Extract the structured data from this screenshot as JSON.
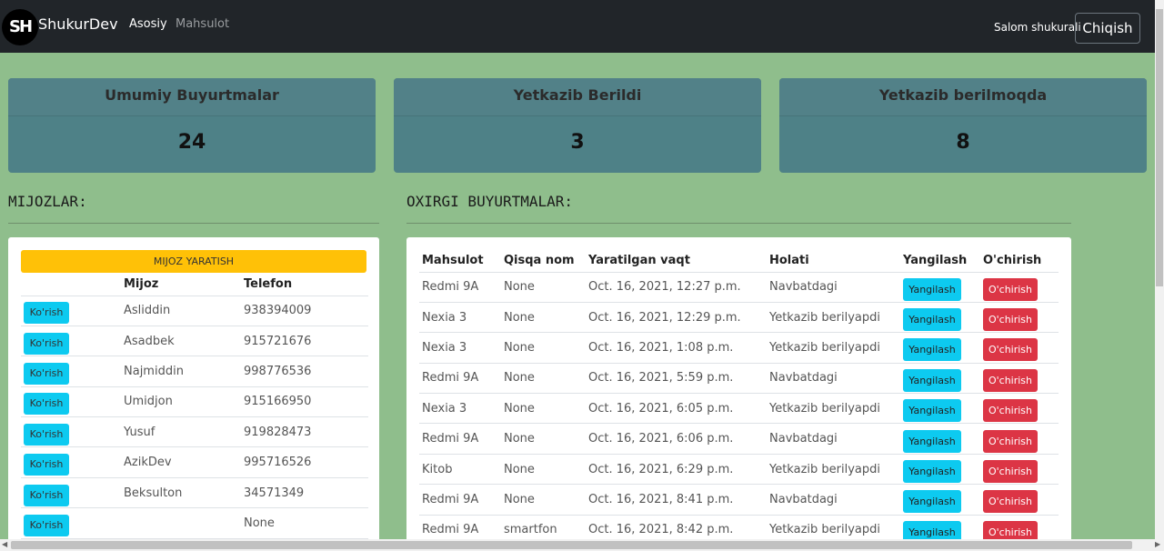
{
  "navbar": {
    "logo_text": "SH",
    "brand": "ShukurDev",
    "links": [
      "Asosiy",
      "Mahsulot"
    ],
    "greeting": "Salom shukurali",
    "logout_label": "Chiqish"
  },
  "stats": [
    {
      "title": "Umumiy Buyurtmalar",
      "value": "24"
    },
    {
      "title": "Yetkazib Berildi",
      "value": "3"
    },
    {
      "title": "Yetkazib berilmoqda",
      "value": "8"
    }
  ],
  "clients": {
    "title": "MIJOZLAR:",
    "create_label": "MIJOZ YARATISH",
    "headers": [
      "",
      "Mijoz",
      "Telefon"
    ],
    "view_label": "Ko'rish",
    "rows": [
      {
        "name": "Asliddin",
        "phone": "938394009"
      },
      {
        "name": "Asadbek",
        "phone": "915721676"
      },
      {
        "name": "Najmiddin",
        "phone": "998776536"
      },
      {
        "name": "Umidjon",
        "phone": "915166950"
      },
      {
        "name": "Yusuf",
        "phone": "919828473"
      },
      {
        "name": "AzikDev",
        "phone": "995716526"
      },
      {
        "name": "Beksulton",
        "phone": "34571349"
      },
      {
        "name": "",
        "phone": "None"
      }
    ]
  },
  "orders": {
    "title": "OXIRGI BUYURTMALAR:",
    "headers": [
      "Mahsulot",
      "Qisqa nom",
      "Yaratilgan vaqt",
      "Holati",
      "Yangilash",
      "O'chirish"
    ],
    "update_label": "Yangilash",
    "delete_label": "O'chirish",
    "rows": [
      {
        "product": "Redmi 9A",
        "short": "None",
        "created": "Oct. 16, 2021, 12:27 p.m.",
        "status": "Navbatdagi"
      },
      {
        "product": "Nexia 3",
        "short": "None",
        "created": "Oct. 16, 2021, 12:29 p.m.",
        "status": "Yetkazib berilyapdi"
      },
      {
        "product": "Nexia 3",
        "short": "None",
        "created": "Oct. 16, 2021, 1:08 p.m.",
        "status": "Yetkazib berilyapdi"
      },
      {
        "product": "Redmi 9A",
        "short": "None",
        "created": "Oct. 16, 2021, 5:59 p.m.",
        "status": "Navbatdagi"
      },
      {
        "product": "Nexia 3",
        "short": "None",
        "created": "Oct. 16, 2021, 6:05 p.m.",
        "status": "Yetkazib berilyapdi"
      },
      {
        "product": "Redmi 9A",
        "short": "None",
        "created": "Oct. 16, 2021, 6:06 p.m.",
        "status": "Navbatdagi"
      },
      {
        "product": "Kitob",
        "short": "None",
        "created": "Oct. 16, 2021, 6:29 p.m.",
        "status": "Yetkazib berilyapdi"
      },
      {
        "product": "Redmi 9A",
        "short": "None",
        "created": "Oct. 16, 2021, 8:41 p.m.",
        "status": "Navbatdagi"
      },
      {
        "product": "Redmi 9A",
        "short": "smartfon",
        "created": "Oct. 16, 2021, 8:42 p.m.",
        "status": "Yetkazib berilyapdi"
      }
    ]
  },
  "colors": {
    "page_bg": "#8fbe8c",
    "navbar_bg": "#212529",
    "card_bg": "#4e8187",
    "info": "#0dcaf0",
    "danger": "#dc3545",
    "warning": "#ffc107"
  }
}
